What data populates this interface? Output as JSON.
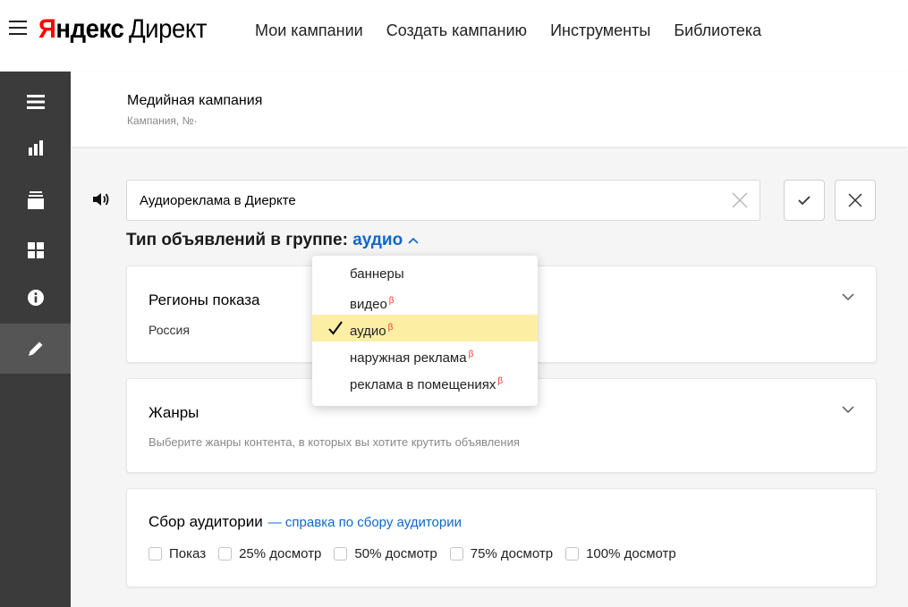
{
  "header": {
    "logo_ya": "Я",
    "logo_rest": "ндекс",
    "logo_product": "Директ",
    "nav": [
      "Мои кампании",
      "Создать кампанию",
      "Инструменты",
      "Библиотека"
    ]
  },
  "sidebar": {
    "items": [
      {
        "icon": "menu-icon"
      },
      {
        "icon": "stats-icon"
      },
      {
        "icon": "layers-icon"
      },
      {
        "icon": "grid-icon"
      },
      {
        "icon": "info-icon"
      },
      {
        "icon": "pencil-icon",
        "active": true
      }
    ]
  },
  "campaign": {
    "title": "Медийная кампания",
    "subtitle": "Кампания, №·"
  },
  "ad_group": {
    "name_value": "Аудиореклама в Диеркте",
    "type_label": "Тип объявлений в группе:",
    "type_value": "аудио"
  },
  "dropdown": {
    "items": [
      {
        "label": "баннеры",
        "beta": ""
      },
      {
        "label": "видео",
        "beta": "β"
      },
      {
        "label": "аудио",
        "beta": "β",
        "selected": true
      },
      {
        "label": "наружная реклама",
        "beta": "β"
      },
      {
        "label": "реклама в помещениях",
        "beta": "β"
      }
    ]
  },
  "regions": {
    "title": "Регионы показа",
    "value": "Россия"
  },
  "genres": {
    "title": "Жанры",
    "hint": "Выберите жанры контента, в которых вы хотите крутить объявления"
  },
  "audience": {
    "title": "Сбор аудитории",
    "link": "— справка по сбору аудитории",
    "checkboxes": [
      "Показ",
      "25% досмотр",
      "50% досмотр",
      "75% досмотр",
      "100% досмотр"
    ]
  },
  "colors": {
    "brand_red": "#ff0000",
    "link_blue": "#1166cc",
    "sidebar_bg": "#3b3b3b",
    "selected_bg": "#fcefa3",
    "beta_red": "#ff3333"
  }
}
